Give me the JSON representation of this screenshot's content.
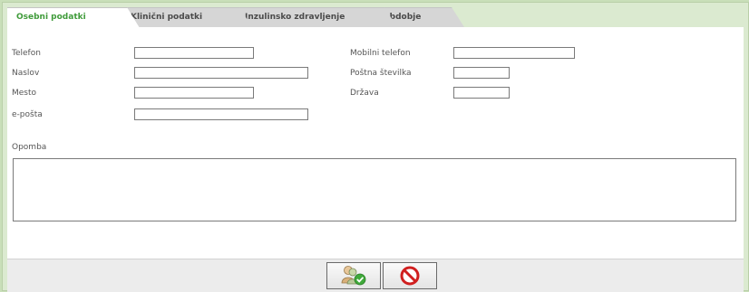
{
  "tabs": [
    {
      "label": "Osebni podatki",
      "active": true
    },
    {
      "label": "Klinični podatki",
      "active": false
    },
    {
      "label": "Inzulinsko zdravljenje",
      "active": false
    },
    {
      "label": "Obdobje",
      "active": false
    }
  ],
  "form": {
    "telefon": {
      "label": "Telefon",
      "value": ""
    },
    "naslov": {
      "label": "Naslov",
      "value": ""
    },
    "mesto": {
      "label": "Mesto",
      "value": ""
    },
    "eposta": {
      "label": "e-pošta",
      "value": ""
    },
    "mobilni": {
      "label": "Mobilni telefon",
      "value": ""
    },
    "postna": {
      "label": "Poštna številka",
      "value": ""
    },
    "drzava": {
      "label": "Država",
      "value": ""
    },
    "opomba": {
      "label": "Opomba",
      "value": ""
    }
  },
  "buttons": {
    "save_icon": "user-save-check-icon",
    "cancel_icon": "cancel-circle-icon"
  },
  "colors": {
    "background": "#c9dfb9",
    "active_tab_text": "#3f9b3a",
    "tab_underline": "#8fbf7a"
  }
}
